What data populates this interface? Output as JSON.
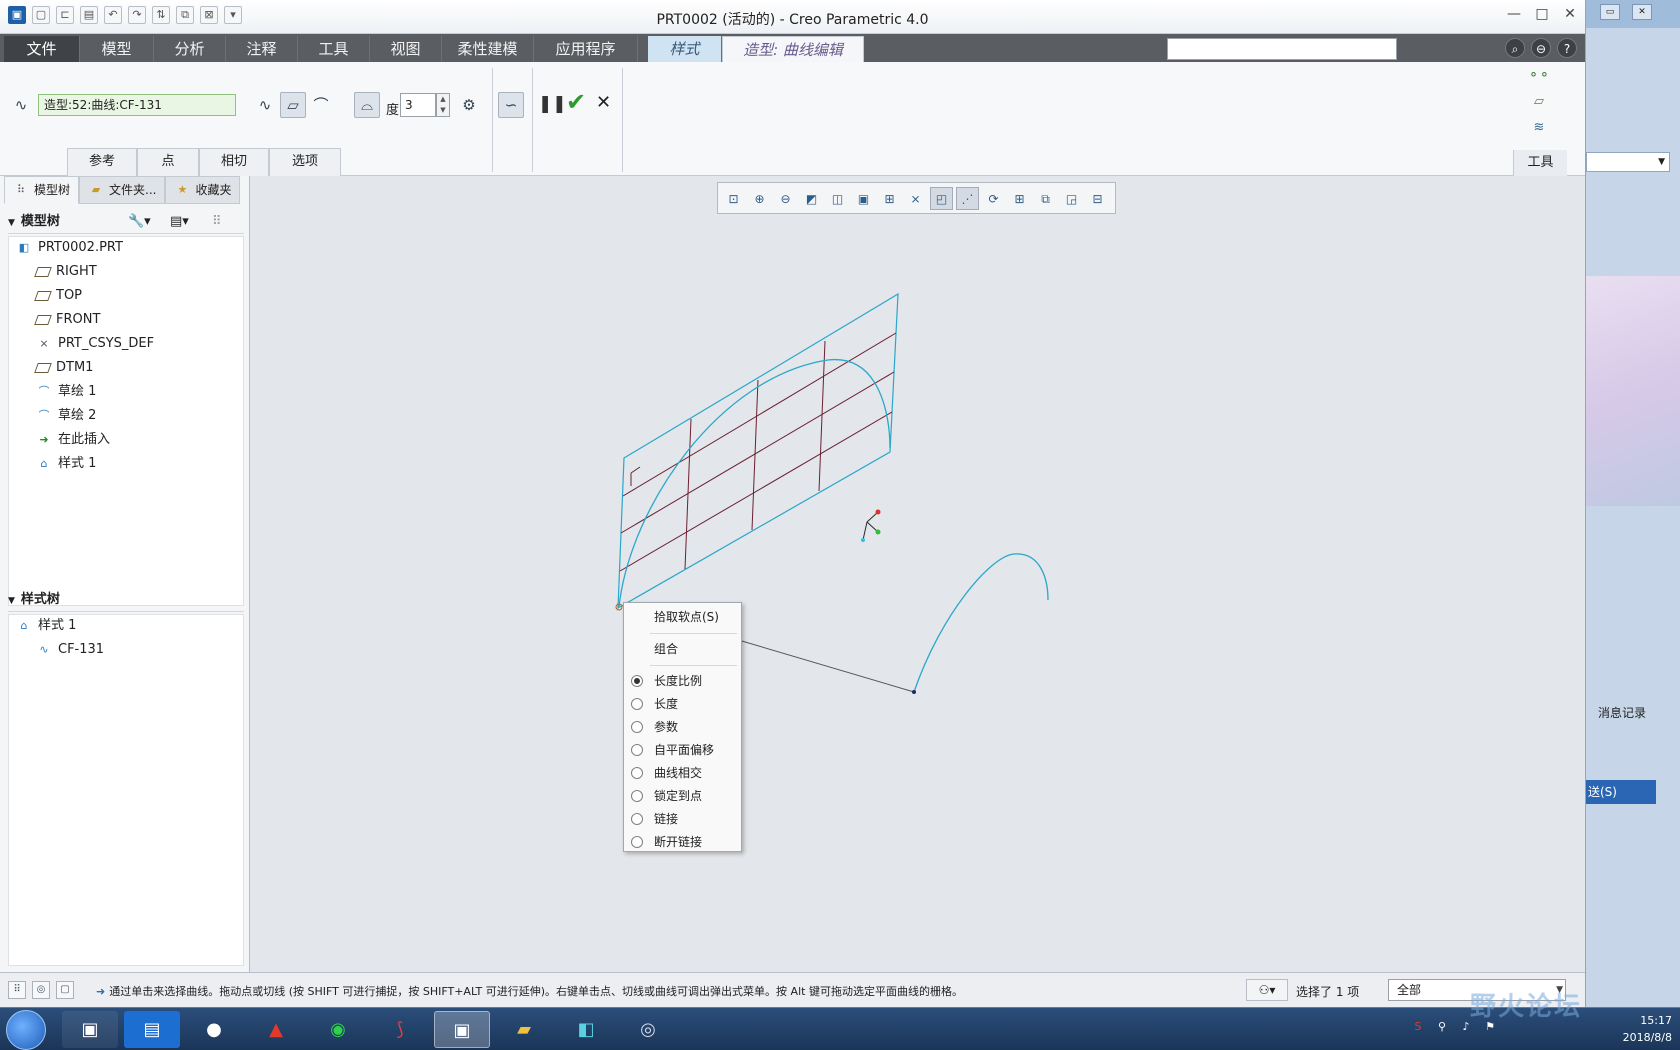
{
  "window": {
    "title": "PRT0002 (活动的) - Creo Parametric 4.0",
    "controls": {
      "minimize": "—",
      "maximize": "□",
      "close": "✕"
    }
  },
  "ribbon_tabs": [
    {
      "label": "文件"
    },
    {
      "label": "模型"
    },
    {
      "label": "分析"
    },
    {
      "label": "注释"
    },
    {
      "label": "工具"
    },
    {
      "label": "视图"
    },
    {
      "label": "柔性建模"
    },
    {
      "label": "应用程序"
    },
    {
      "label": "样式"
    },
    {
      "label": "造型: 曲线编辑"
    }
  ],
  "ribbon": {
    "curve_field": "造型:52:曲线:CF-131",
    "degree_label": "度",
    "degree_value": "3",
    "subtabs": [
      "参考",
      "点",
      "相切",
      "选项"
    ],
    "tools_label": "工具"
  },
  "left_panel": {
    "tabs": [
      "模型树",
      "文件夹...",
      "收藏夹"
    ],
    "model_tree_title": "模型树",
    "model_tree": [
      "PRT0002.PRT",
      "RIGHT",
      "TOP",
      "FRONT",
      "PRT_CSYS_DEF",
      "DTM1",
      "草绘 1",
      "草绘 2",
      "在此插入",
      "样式 1"
    ],
    "style_tree_title": "样式树",
    "style_tree": [
      "样式 1",
      "CF-131"
    ]
  },
  "context_menu": {
    "pick_soft_point": "拾取软点(S)",
    "combine": "组合",
    "options": [
      "长度比例",
      "长度",
      "参数",
      "自平面偏移",
      "曲线相交",
      "锁定到点",
      "链接",
      "断开链接"
    ],
    "selected_option": "长度比例"
  },
  "statusbar": {
    "message": "通过单击来选择曲线。拖动点或切线 (按 SHIFT 可进行捕捉，按 SHIFT+ALT 可进行延伸)。右键单击点、切线或曲线可调出弹出式菜单。按 Alt 键可拖动选定平面曲线的栅格。",
    "selected_count": "选择了 1 项",
    "filter": "全部"
  },
  "background_window": {
    "message_log": "消息记录",
    "send": "送(S)"
  },
  "taskbar": {
    "time": "15:17",
    "date": "2018/8/8",
    "watermark": "野火论坛"
  },
  "colors": {
    "curve": "#2aa7c9",
    "grid_line": "#6a2030",
    "accent_ok": "#2f9a2f",
    "file_tab": "#3f4246"
  }
}
